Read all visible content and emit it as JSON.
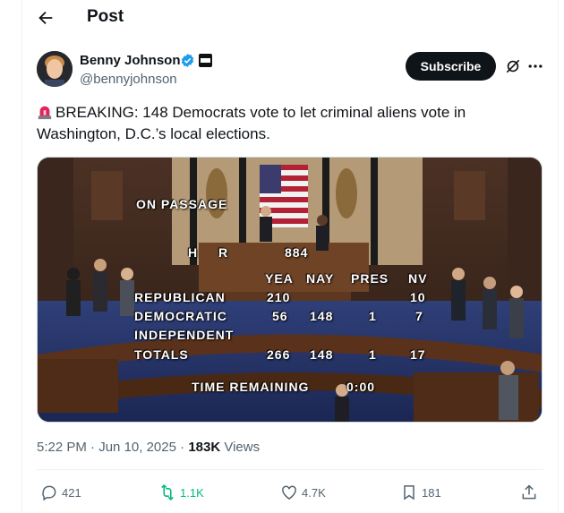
{
  "header": {
    "title": "Post"
  },
  "author": {
    "name": "Benny Johnson",
    "handle": "@bennyjohnson",
    "subscribe_label": "Subscribe"
  },
  "tweet": {
    "text": "BREAKING: 148 Democrats vote to let criminal aliens vote in Washington, D.C.’s local elections."
  },
  "vote_graphic": {
    "heading": "ON PASSAGE",
    "bill_label": "H R",
    "bill_number": "884",
    "columns": [
      "YEA",
      "NAY",
      "PRES",
      "NV"
    ],
    "rows": [
      {
        "party": "REPUBLICAN",
        "yea": "210",
        "nay": "",
        "pres": "",
        "nv": "10"
      },
      {
        "party": "DEMOCRATIC",
        "yea": "56",
        "nay": "148",
        "pres": "1",
        "nv": "7"
      },
      {
        "party": "INDEPENDENT",
        "yea": "",
        "nay": "",
        "pres": "",
        "nv": ""
      },
      {
        "party": "TOTALS",
        "yea": "266",
        "nay": "148",
        "pres": "1",
        "nv": "17"
      }
    ],
    "time_label": "TIME REMAINING",
    "time_value": "0:00"
  },
  "meta": {
    "time": "5:22 PM",
    "sep1": "·",
    "date": "Jun 10, 2025",
    "sep2": "·",
    "views_count": "183K",
    "views_label": "Views"
  },
  "actions": {
    "replies": "421",
    "reposts": "1.1K",
    "likes": "4.7K",
    "bookmarks": "181"
  },
  "colors": {
    "repost_green": "#00ba7c",
    "text_primary": "#0f1419",
    "text_secondary": "#536471",
    "verified_blue": "#1d9bf0"
  },
  "icons": [
    "back-arrow-icon",
    "verified-badge-icon",
    "affiliate-badge-icon",
    "grok-icon",
    "more-icon",
    "siren-emoji-icon",
    "reply-icon",
    "repost-icon",
    "like-icon",
    "bookmark-icon",
    "share-icon"
  ]
}
